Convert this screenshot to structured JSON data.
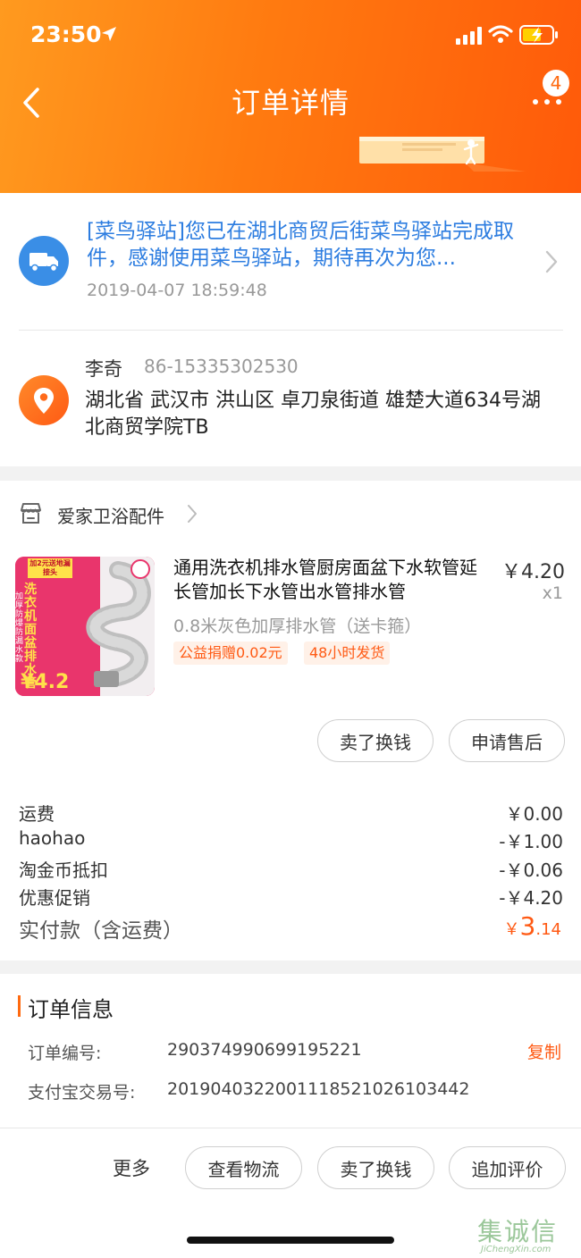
{
  "status": {
    "time": "23:50"
  },
  "header": {
    "title": "订单详情",
    "badge_count": "4",
    "accent": "#ff6a10"
  },
  "logistics": {
    "text": "[菜鸟驿站]您已在湖北商贸后街菜鸟驿站完成取件，感谢使用菜鸟驿站，期待再次为您...",
    "time": "2019-04-07 18:59:48"
  },
  "receiver": {
    "name": "李奇",
    "phone": "86-15335302530",
    "address": "湖北省 武汉市 洪山区 卓刀泉街道 雄楚大道634号湖北商贸学院TB"
  },
  "shop": {
    "name": "爱家卫浴配件"
  },
  "product": {
    "title": "通用洗衣机排水管厨房面盆下水软管延长管加长下水管出水管排水管",
    "price": "￥4.20",
    "qty": "x1",
    "sku": "0.8米灰色加厚排水管（送卡箍）",
    "tags": [
      "公益捐赠0.02元",
      "48小时发货"
    ],
    "thumb_top_text": "加2元送地漏接头",
    "thumb_main_text": "洗衣机面盆排水管",
    "thumb_side_text": "加厚防爆防漏水款",
    "thumb_price": "¥4.2"
  },
  "item_actions": {
    "sell": "卖了换钱",
    "after_sale": "申请售后"
  },
  "fees": [
    {
      "label": "运费",
      "value": "￥0.00"
    },
    {
      "label": "haohao",
      "value": "-￥1.00"
    },
    {
      "label": "淘金币抵扣",
      "value": "-￥0.06"
    },
    {
      "label": "优惠促销",
      "value": "-￥4.20"
    }
  ],
  "total": {
    "label": "实付款（含运费）",
    "currency": "￥",
    "int": "3",
    "dec": ".14"
  },
  "order_info": {
    "title": "订单信息",
    "order_no_label": "订单编号:",
    "order_no": "290374990699195221",
    "copy": "复制",
    "alipay_label": "支付宝交易号:",
    "alipay_no": "2019040322001118521026103442"
  },
  "bottom": {
    "more": "更多",
    "logistics": "查看物流",
    "sell": "卖了换钱",
    "review": "追加评价"
  },
  "watermark": {
    "text": "集诚信",
    "sub": "JiChengXin.com"
  }
}
